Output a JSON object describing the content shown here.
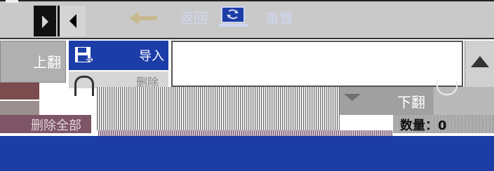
{
  "toolbar": {
    "nav_left_icon": "triangle-right-icon",
    "nav_right_icon": "triangle-left-icon"
  },
  "left_panel": {
    "page_up_label": "上翻",
    "delete_all_label": "删除全部"
  },
  "menu": {
    "import_label": "导入",
    "import_icon": "floppy-disk-arrow-icon",
    "delete_label": "删除"
  },
  "list": {
    "scroll_up_icon": "triangle-up-icon",
    "page_down_label": "下翻",
    "count_label": "数量：0"
  },
  "bottom_bar": {
    "back_label": "返回",
    "back_icon": "back-arrow-icon",
    "reset_label": "重置",
    "reset_icon": "monitor-refresh-icon"
  },
  "colors": {
    "accent_blue": "#1c3da8",
    "panel_gray": "#c9c9c9",
    "delete_purple": "#7d5566"
  }
}
